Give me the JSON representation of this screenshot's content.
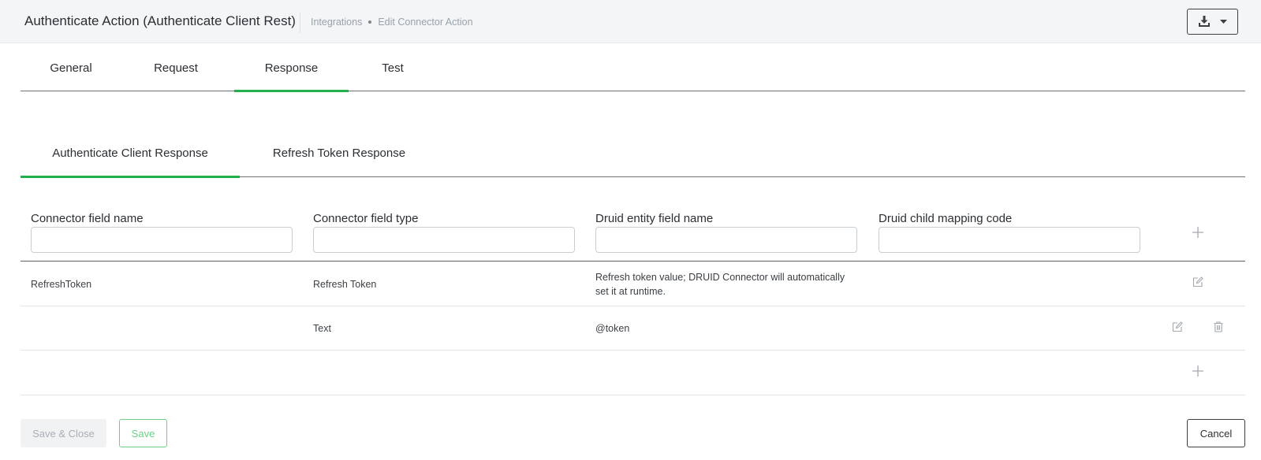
{
  "header": {
    "title": "Authenticate Action (Authenticate Client Rest)",
    "breadcrumb": [
      "Integrations",
      "Edit Connector Action"
    ],
    "export_icon": "download-icon",
    "dropdown_icon": "caret-down-icon"
  },
  "tabs": [
    {
      "label": "General",
      "active": false
    },
    {
      "label": "Request",
      "active": false
    },
    {
      "label": "Response",
      "active": true
    },
    {
      "label": "Test",
      "active": false
    }
  ],
  "subtabs": [
    {
      "label": "Authenticate Client Response",
      "active": true
    },
    {
      "label": "Refresh Token Response",
      "active": false
    }
  ],
  "grid": {
    "columns": [
      {
        "label": "Connector field name",
        "filter": ""
      },
      {
        "label": "Connector field type",
        "filter": ""
      },
      {
        "label": "Druid entity field name",
        "filter": ""
      },
      {
        "label": "Druid child mapping code",
        "filter": ""
      }
    ],
    "rows": [
      {
        "field_name": "RefreshToken",
        "field_type": "Refresh Token",
        "entity_field": "Refresh token value; DRUID Connector will automatically set it at runtime.",
        "child_code": ""
      },
      {
        "field_name": "",
        "field_type": "Text",
        "entity_field": "@token",
        "child_code": ""
      }
    ]
  },
  "footer": {
    "save_close_label": "Save & Close",
    "save_label": "Save",
    "cancel_label": "Cancel"
  },
  "colors": {
    "accent": "#22b04a",
    "header_bg": "#f3f5f7",
    "text": "#2b2f33",
    "muted": "#9aa2aa"
  }
}
